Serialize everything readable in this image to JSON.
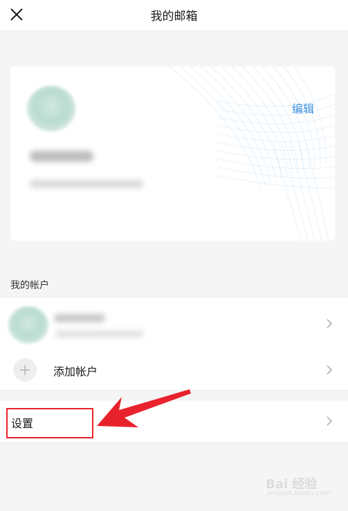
{
  "header": {
    "title": "我的邮箱",
    "close_icon": "close-icon"
  },
  "profile": {
    "edit_label": "编辑"
  },
  "accounts": {
    "section_label": "我的帐户",
    "add_label": "添加帐户",
    "add_icon": "plus-icon"
  },
  "settings": {
    "label": "设置"
  },
  "colors": {
    "accent": "#3c8fe0",
    "annotation": "#e8222d",
    "background": "#f5f5f5"
  },
  "watermark": {
    "main": "Bai 经验",
    "sub": "jingyan.baidu.com"
  }
}
